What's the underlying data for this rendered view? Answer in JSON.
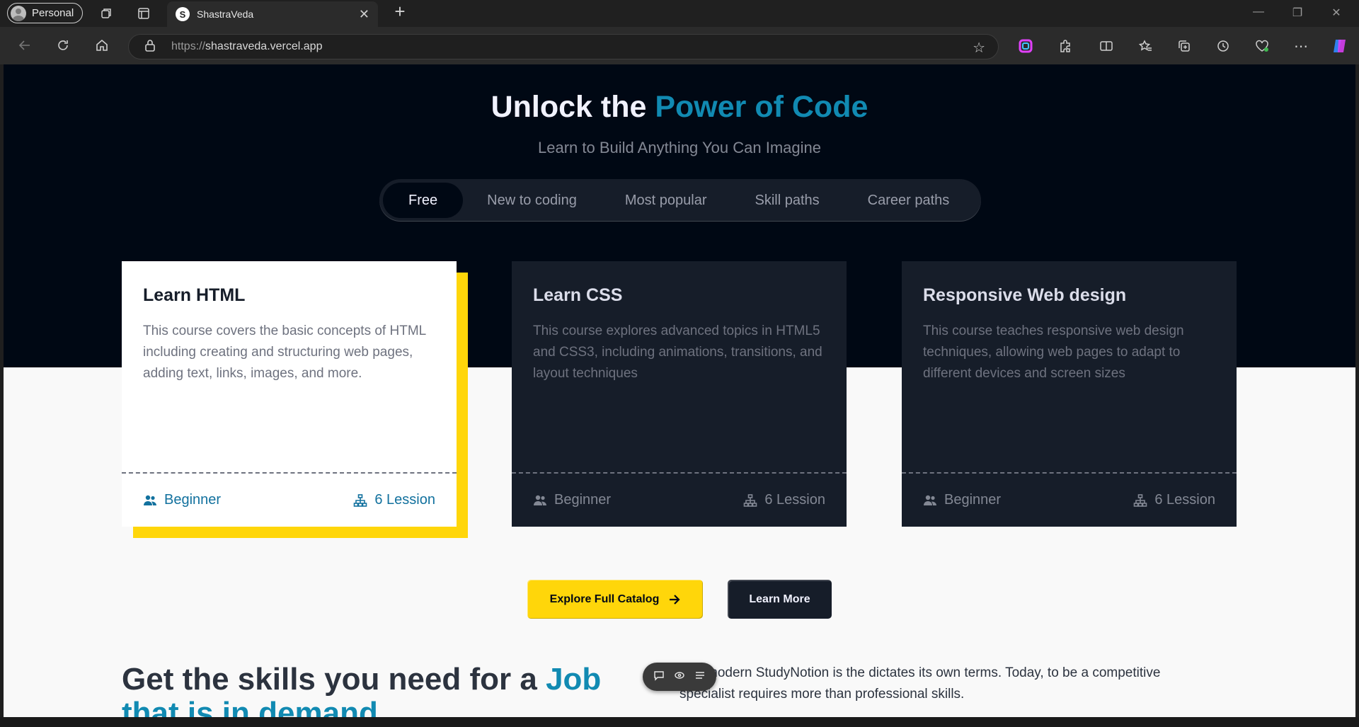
{
  "browser": {
    "profile_label": "Personal",
    "tab_title": "ShastraVeda",
    "tab_favicon": "S",
    "url_protocol": "https://",
    "url_host": "shastraveda.vercel.app"
  },
  "hero": {
    "title_prefix": "Unlock the ",
    "title_highlight": "Power of Code",
    "subtitle": "Learn to Build Anything You Can Imagine",
    "tabs": [
      "Free",
      "New to coding",
      "Most popular",
      "Skill paths",
      "Career paths"
    ],
    "active_tab": "Free"
  },
  "cards": [
    {
      "title": "Learn HTML",
      "description": "This course covers the basic concepts of HTML including creating and structuring web pages, adding text, links, images, and more.",
      "level": "Beginner",
      "lessons": "6 Lession"
    },
    {
      "title": "Learn CSS",
      "description": "This course explores advanced topics in HTML5 and CSS3, including animations, transitions, and layout techniques",
      "level": "Beginner",
      "lessons": "6 Lession"
    },
    {
      "title": "Responsive Web design",
      "description": "This course teaches responsive web design techniques, allowing web pages to adapt to different devices and screen sizes",
      "level": "Beginner",
      "lessons": "6 Lession"
    }
  ],
  "buttons": {
    "explore_label": "Explore Full Catalog",
    "learn_more_label": "Learn More"
  },
  "skills": {
    "title_prefix": "Get the skills you need for a ",
    "title_highlight": "Job that is in demand.",
    "text": "The modern StudyNotion is the dictates its own terms. Today, to be a competitive specialist requires more than professional skills."
  },
  "colors": {
    "accent_blue": "#118ab2",
    "accent_yellow": "#ffd60a",
    "hero_bg": "#000814",
    "card_bg": "#161d29"
  }
}
